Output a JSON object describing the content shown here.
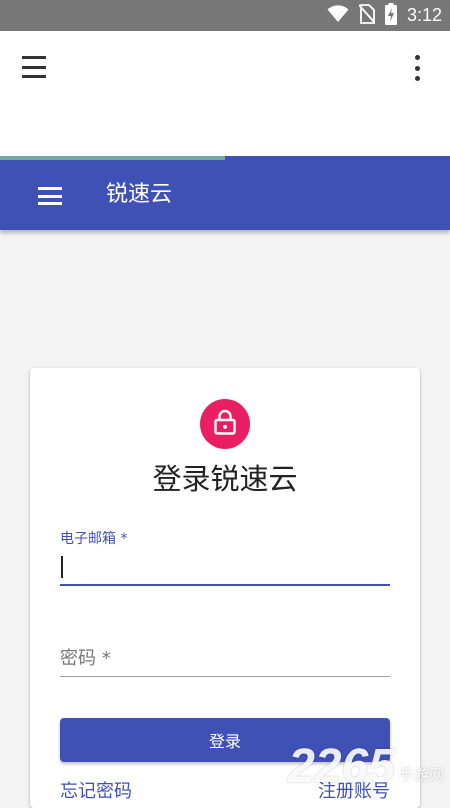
{
  "status_bar": {
    "time": "3:12",
    "icons": [
      "wifi-icon",
      "no-sim-icon",
      "battery-charging-icon"
    ]
  },
  "browser": {
    "menu_icon": "hamburger-menu-icon",
    "more_icon": "more-vert-icon",
    "progress": 0.5,
    "progress_color": "#74a9a8"
  },
  "app_bar": {
    "title": "锐速云",
    "menu_icon": "hamburger-menu-icon",
    "color": "#3f51b5"
  },
  "login": {
    "icon": "lock-icon",
    "badge_color": "#e91e63",
    "title": "登录锐速云",
    "email_label": "电子邮箱 *",
    "email_value": "",
    "password_placeholder": "密码 *",
    "password_value": "",
    "submit_label": "登录",
    "forgot_label": "忘记密码",
    "register_label": "注册账号"
  },
  "watermark": {
    "number": "2265",
    "text": "手游网"
  }
}
